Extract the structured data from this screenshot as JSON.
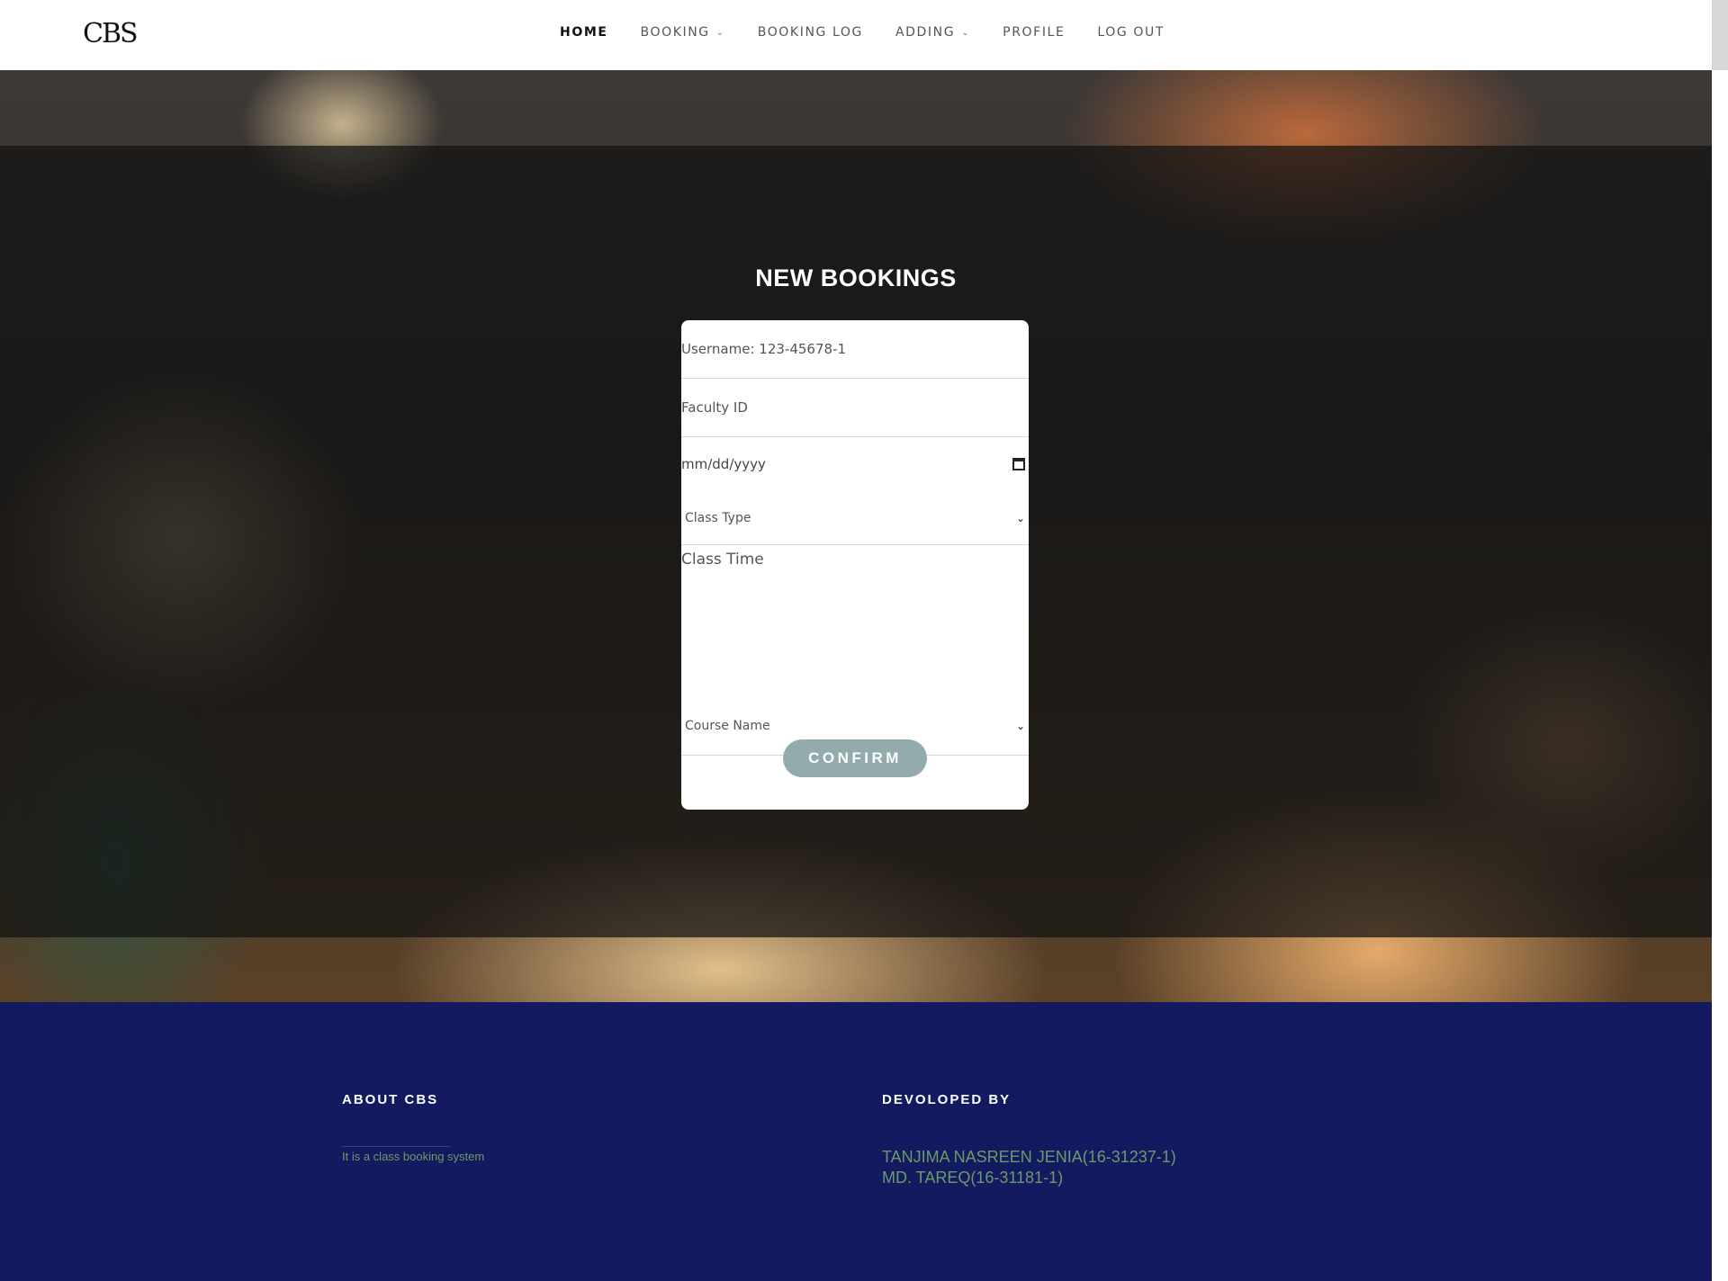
{
  "header": {
    "logo": "CBS",
    "nav": [
      {
        "label": "HOME",
        "active": true
      },
      {
        "label": "BOOKING",
        "dropdown": true
      },
      {
        "label": "BOOKING LOG"
      },
      {
        "label": "ADDING",
        "dropdown": true
      },
      {
        "label": "PROFILE"
      },
      {
        "label": "LOG OUT"
      }
    ]
  },
  "main": {
    "title": "NEW BOOKINGS",
    "form": {
      "username_text": "Username: 123-45678-1",
      "faculty_placeholder": "Faculty ID",
      "date_placeholder": "mm/dd/yyyy",
      "class_type": "Class Type",
      "class_time_placeholder": "Class Time",
      "course_name": "Course Name",
      "confirm_label": "CONFIRM"
    }
  },
  "footer": {
    "about_title": "ABOUT CBS",
    "about_text": "It is a class booking system",
    "dev_title": "DEVOLOPED BY",
    "developers": [
      "TANJIMA NASREEN JENIA(16-31237-1)",
      "MD. TAREQ(16-31181-1)"
    ]
  },
  "colors": {
    "footer_bg": "#131a5f",
    "accent_text": "#6b9a6b",
    "confirm_bg": "#94abad"
  },
  "icons": [
    "chevron-down-icon",
    "calendar-icon"
  ]
}
